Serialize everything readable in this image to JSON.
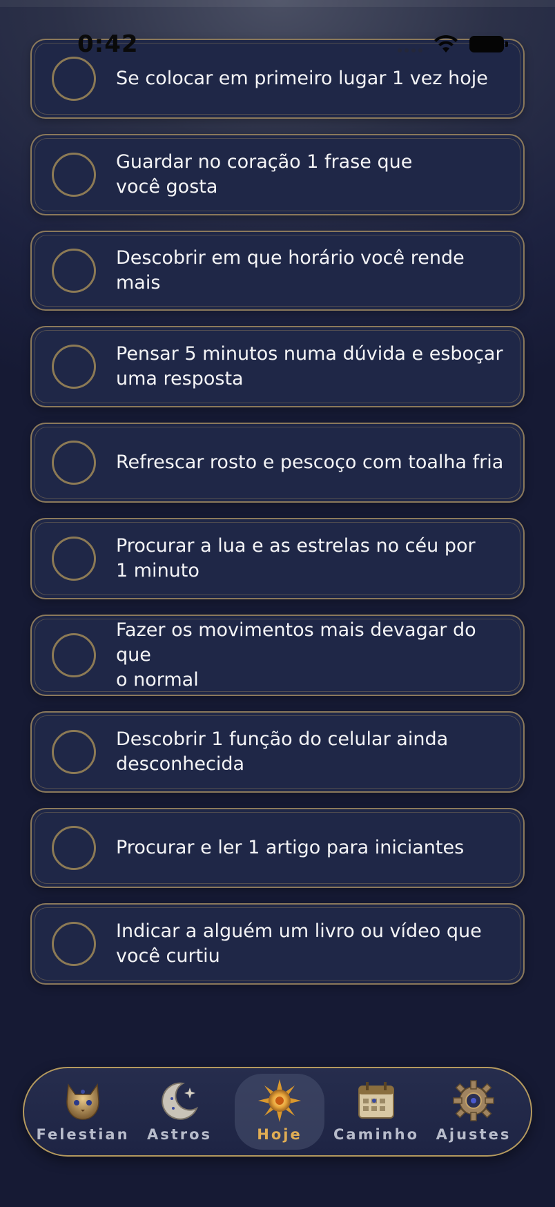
{
  "status_bar": {
    "time": "0:42"
  },
  "tasks": [
    {
      "text": "Se colocar em primeiro lugar 1 vez hoje",
      "checked": false
    },
    {
      "text": "Guardar no coração 1 frase que\nvocê gosta",
      "checked": false
    },
    {
      "text": "Descobrir em que horário você rende mais",
      "checked": false
    },
    {
      "text": "Pensar 5 minutos numa dúvida e esboçar\numa resposta",
      "checked": false
    },
    {
      "text": "Refrescar rosto e pescoço com toalha fria",
      "checked": false
    },
    {
      "text": "Procurar a lua e as estrelas no céu por\n1 minuto",
      "checked": false
    },
    {
      "text": "Fazer os movimentos mais devagar do que\no normal",
      "checked": false
    },
    {
      "text": "Descobrir 1 função do celular ainda\ndesconhecida",
      "checked": false
    },
    {
      "text": "Procurar e ler 1 artigo para iniciantes",
      "checked": false
    },
    {
      "text": "Indicar a alguém um livro ou vídeo que\nvocê curtiu",
      "checked": false
    }
  ],
  "tab_bar": {
    "items": [
      {
        "label": "Felestian",
        "icon": "cat-icon",
        "active": false
      },
      {
        "label": "Astros",
        "icon": "moon-icon",
        "active": false
      },
      {
        "label": "Hoje",
        "icon": "sun-icon",
        "active": true
      },
      {
        "label": "Caminho",
        "icon": "calendar-icon",
        "active": false
      },
      {
        "label": "Ajustes",
        "icon": "gear-icon",
        "active": false
      }
    ]
  },
  "colors": {
    "accent_gold": "#e0ad54",
    "card_border": "#b0966a",
    "card_bg": "#1f2747",
    "background": "#1d2240"
  }
}
